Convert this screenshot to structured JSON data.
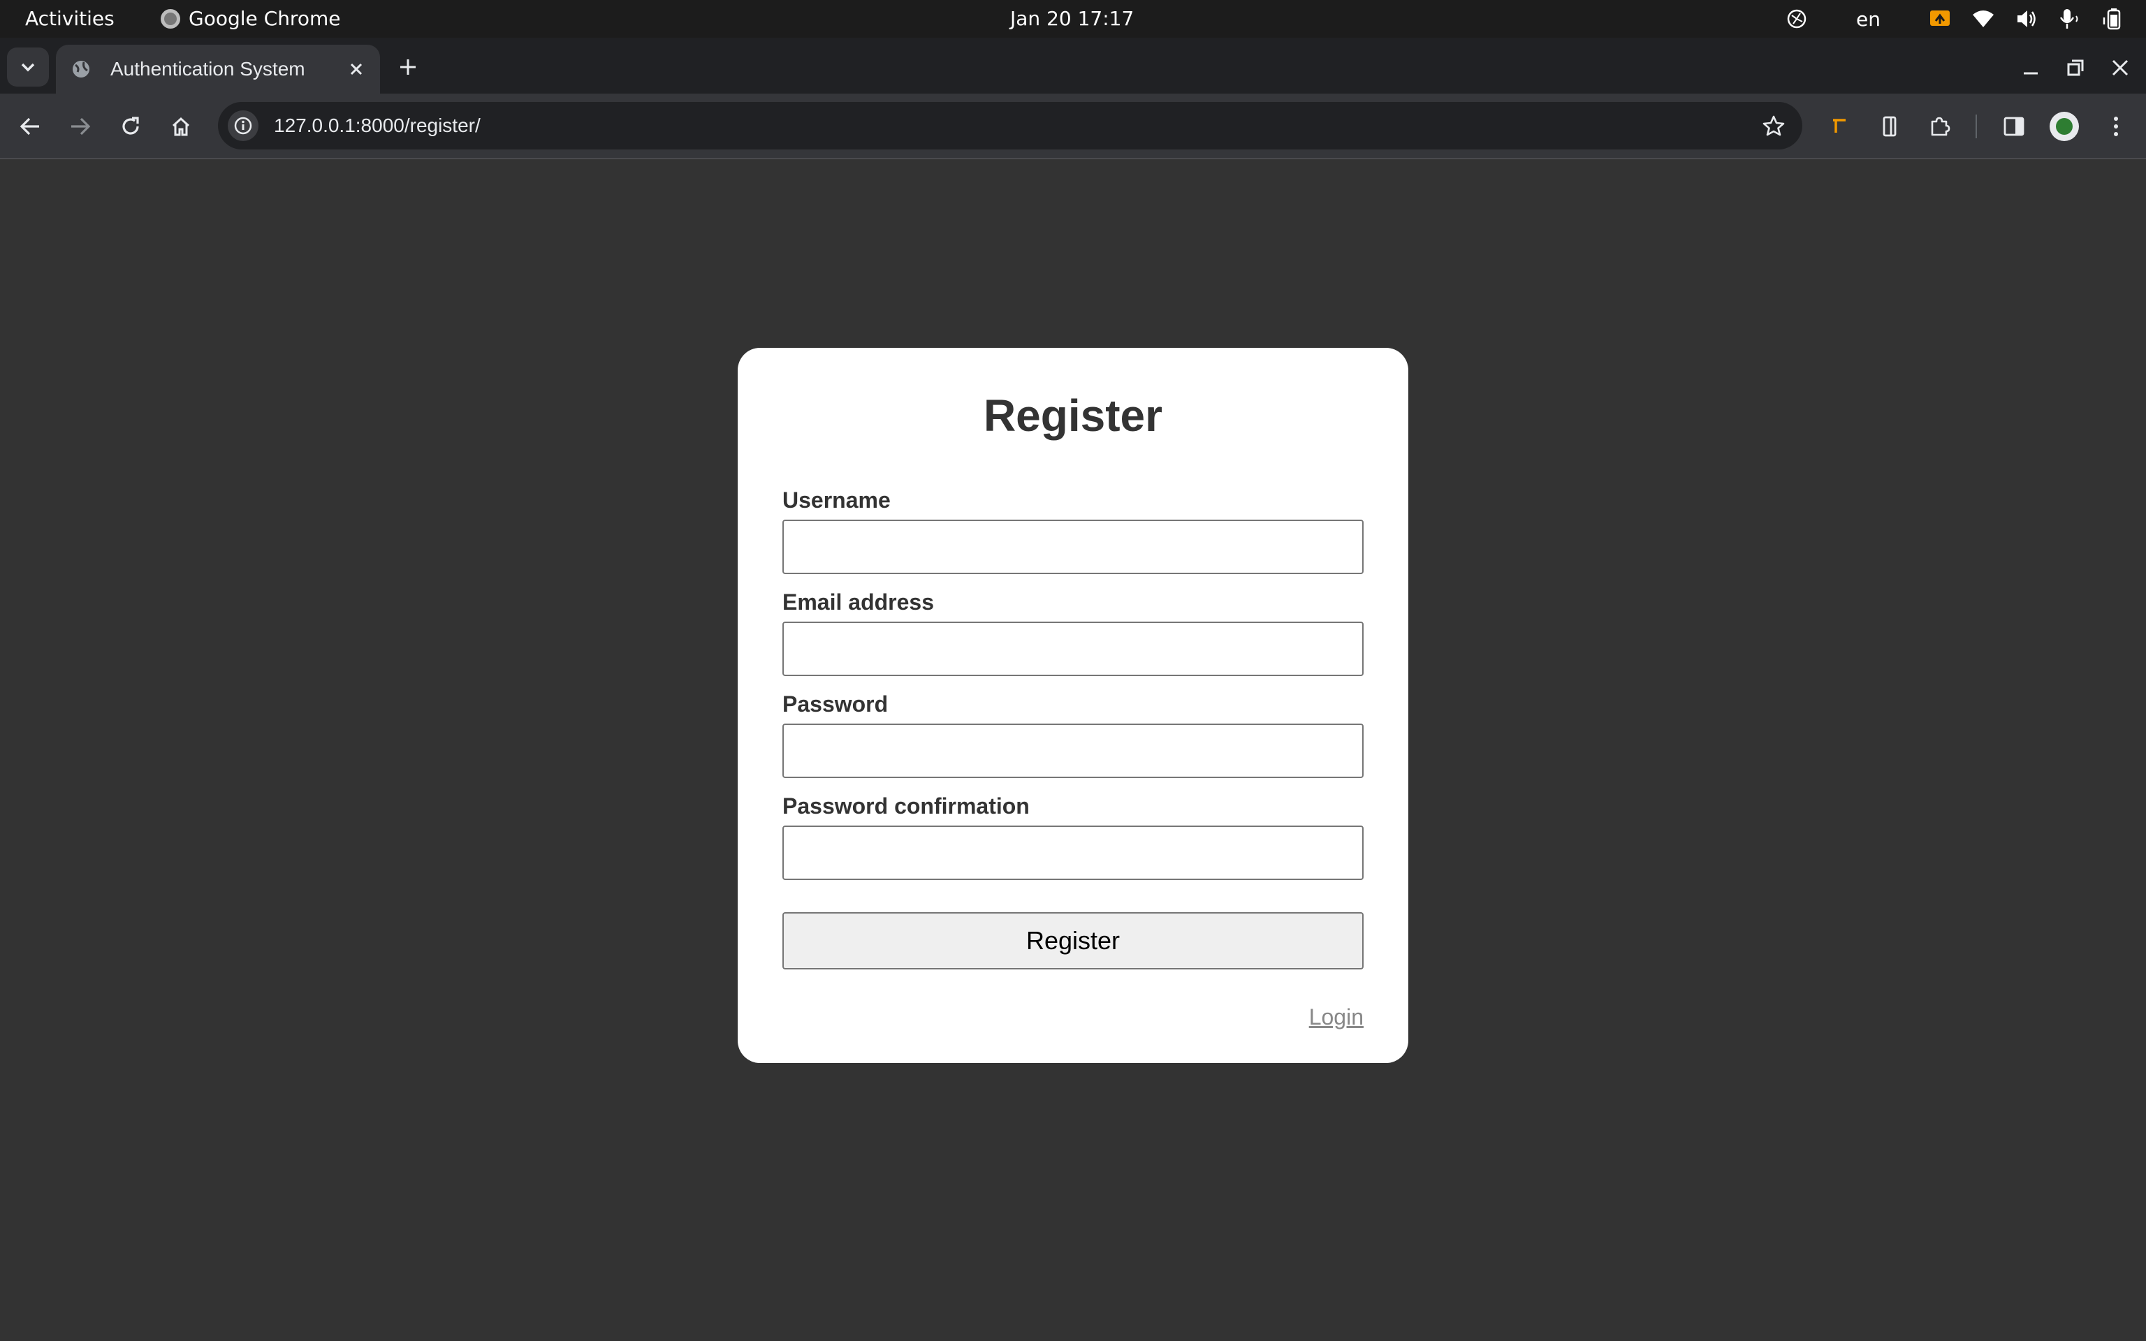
{
  "system_bar": {
    "activities": "Activities",
    "app_name": "Google Chrome",
    "datetime": "Jan 20  17:17",
    "language": "en"
  },
  "browser": {
    "tab_title": "Authentication System",
    "url": "127.0.0.1:8000/register/"
  },
  "form": {
    "heading": "Register",
    "fields": [
      {
        "label": "Username",
        "value": ""
      },
      {
        "label": "Email address",
        "value": ""
      },
      {
        "label": "Password",
        "value": ""
      },
      {
        "label": "Password confirmation",
        "value": ""
      }
    ],
    "submit_label": "Register",
    "login_link": "Login"
  },
  "colors": {
    "page_background": "#333333",
    "card_background": "#ffffff",
    "heading_color": "#333333",
    "link_color": "#888888",
    "accent_orange": "#f29900"
  }
}
